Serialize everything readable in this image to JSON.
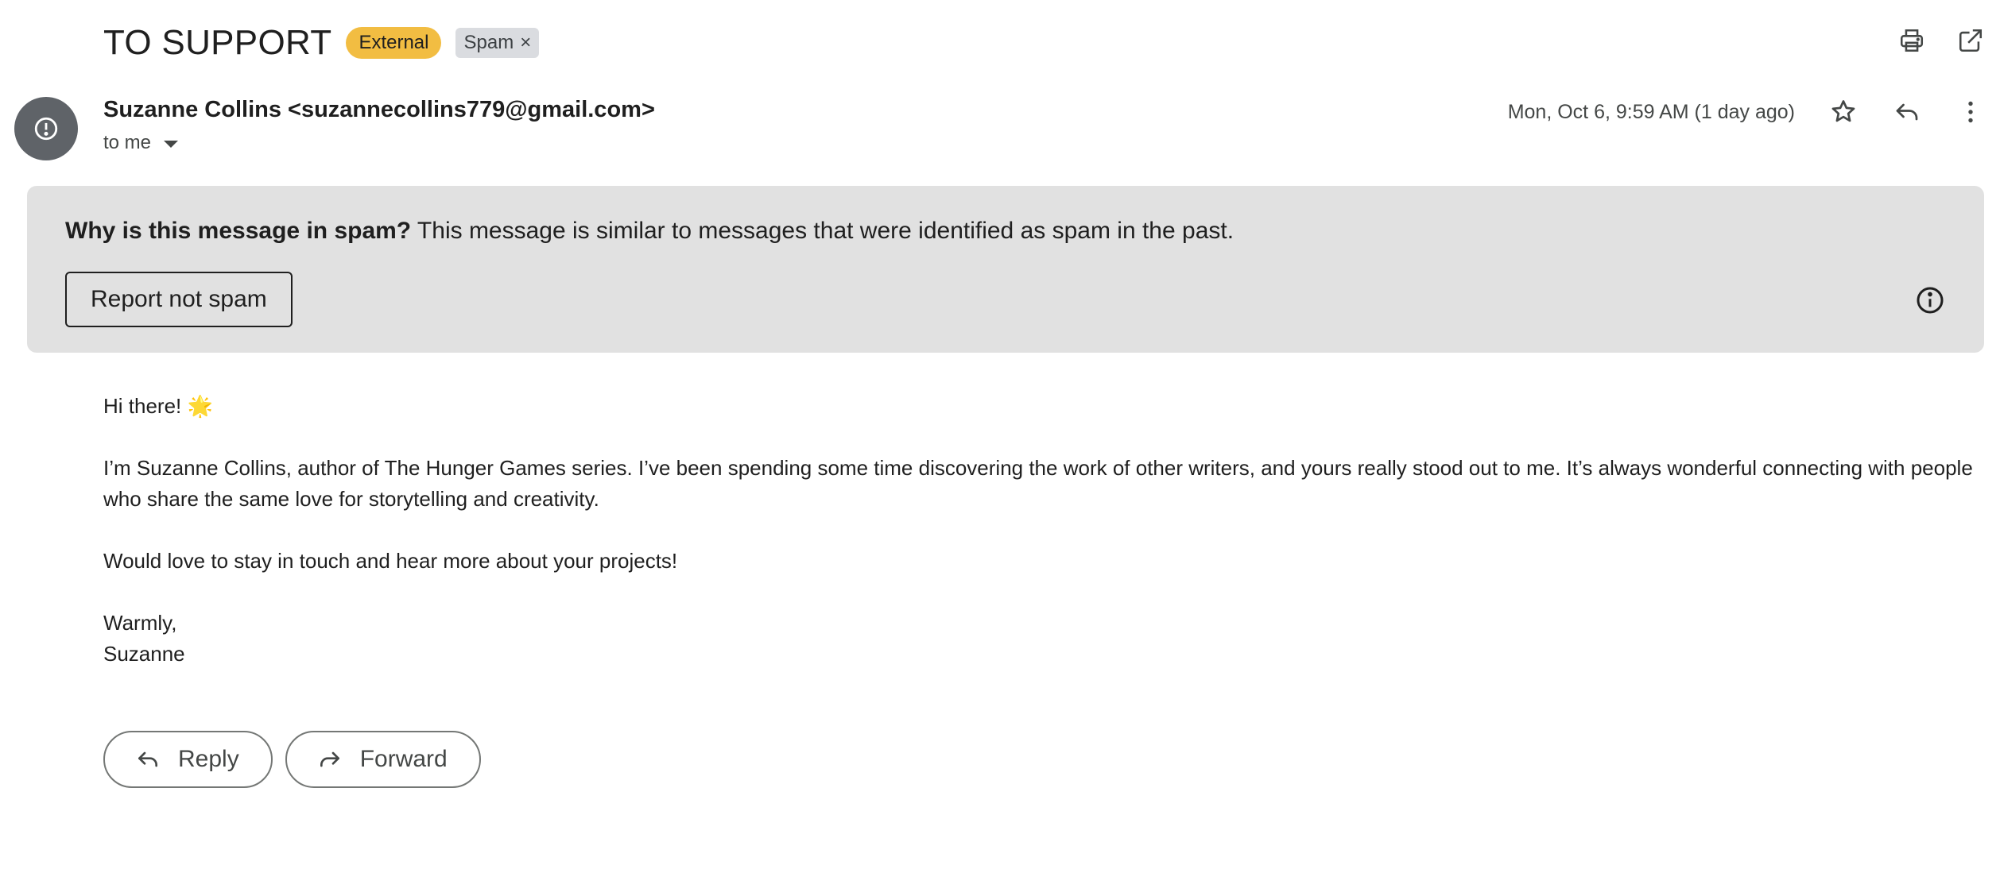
{
  "subject": "TO SUPPORT",
  "labels": {
    "external": "External",
    "spam": "Spam",
    "spam_remove": "×"
  },
  "top_actions": [
    "print-icon",
    "open-in-new-window-icon"
  ],
  "sender": {
    "display": "Suzanne Collins <suzannecollins779@gmail.com>",
    "avatar_icon": "alert-circle-icon",
    "to": "to me"
  },
  "date": "Mon, Oct 6, 9:59 AM (1 day ago)",
  "message_actions": [
    "star-icon",
    "reply-icon",
    "more-vert-icon"
  ],
  "spam_banner": {
    "question": "Why is this message in spam?",
    "explanation": " This message is similar to messages that were identified as spam in the past.",
    "button": "Report not spam",
    "info_icon": "info-icon"
  },
  "body": {
    "greeting": "Hi there! 🌟",
    "para1": "I’m Suzanne Collins, author of The Hunger Games series. I’ve been spending some time discovering the work of other writers, and yours really stood out to me. It’s always wonderful connecting with people who share the same love for storytelling and creativity.",
    "para2": "Would love to stay in touch and hear more about your projects!",
    "signoff": "Warmly,",
    "signature": "Suzanne"
  },
  "buttons": {
    "reply": "Reply",
    "forward": "Forward"
  },
  "colors": {
    "external_label": "#f2bd42",
    "spam_label": "#dadce0",
    "banner_bg": "#e1e1e1",
    "avatar_bg": "#5f6368"
  }
}
